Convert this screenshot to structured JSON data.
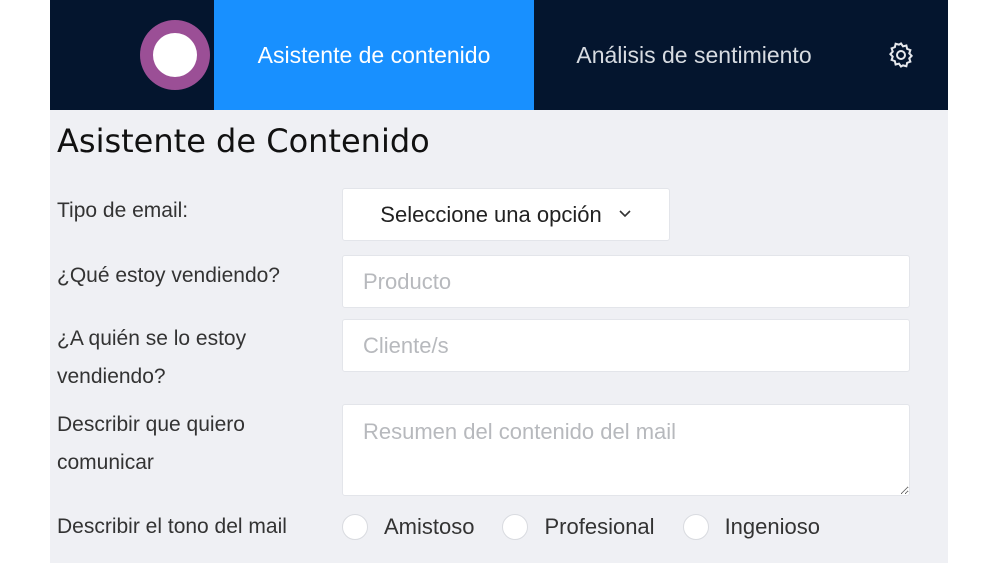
{
  "nav": {
    "logo_icon": "ring-logo-icon",
    "tabs": [
      {
        "label": "Asistente de contenido",
        "active": true
      },
      {
        "label": "Análisis de sentimiento",
        "active": false
      }
    ],
    "settings_icon": "gear-icon"
  },
  "page": {
    "title": "Asistente de Contenido"
  },
  "form": {
    "email_type": {
      "label": "Tipo de email:",
      "selected": "Seleccione una opción",
      "icon": "chevron-down-icon"
    },
    "selling": {
      "label": "¿Qué estoy vendiendo?",
      "placeholder": "Producto",
      "value": ""
    },
    "audience": {
      "label": "¿A quién se lo estoy vendiendo?",
      "placeholder": "Cliente/s",
      "value": ""
    },
    "description": {
      "label": "Describir que quiero comunicar",
      "placeholder": "Resumen del contenido del mail",
      "value": ""
    },
    "tone": {
      "label": "Describir el tono del mail",
      "options": [
        "Amistoso",
        "Profesional",
        "Ingenioso"
      ]
    }
  },
  "colors": {
    "navbar": "#04152e",
    "active_tab": "#1890ff",
    "logo": "#9b4f96",
    "page_bg": "#eff0f4"
  }
}
